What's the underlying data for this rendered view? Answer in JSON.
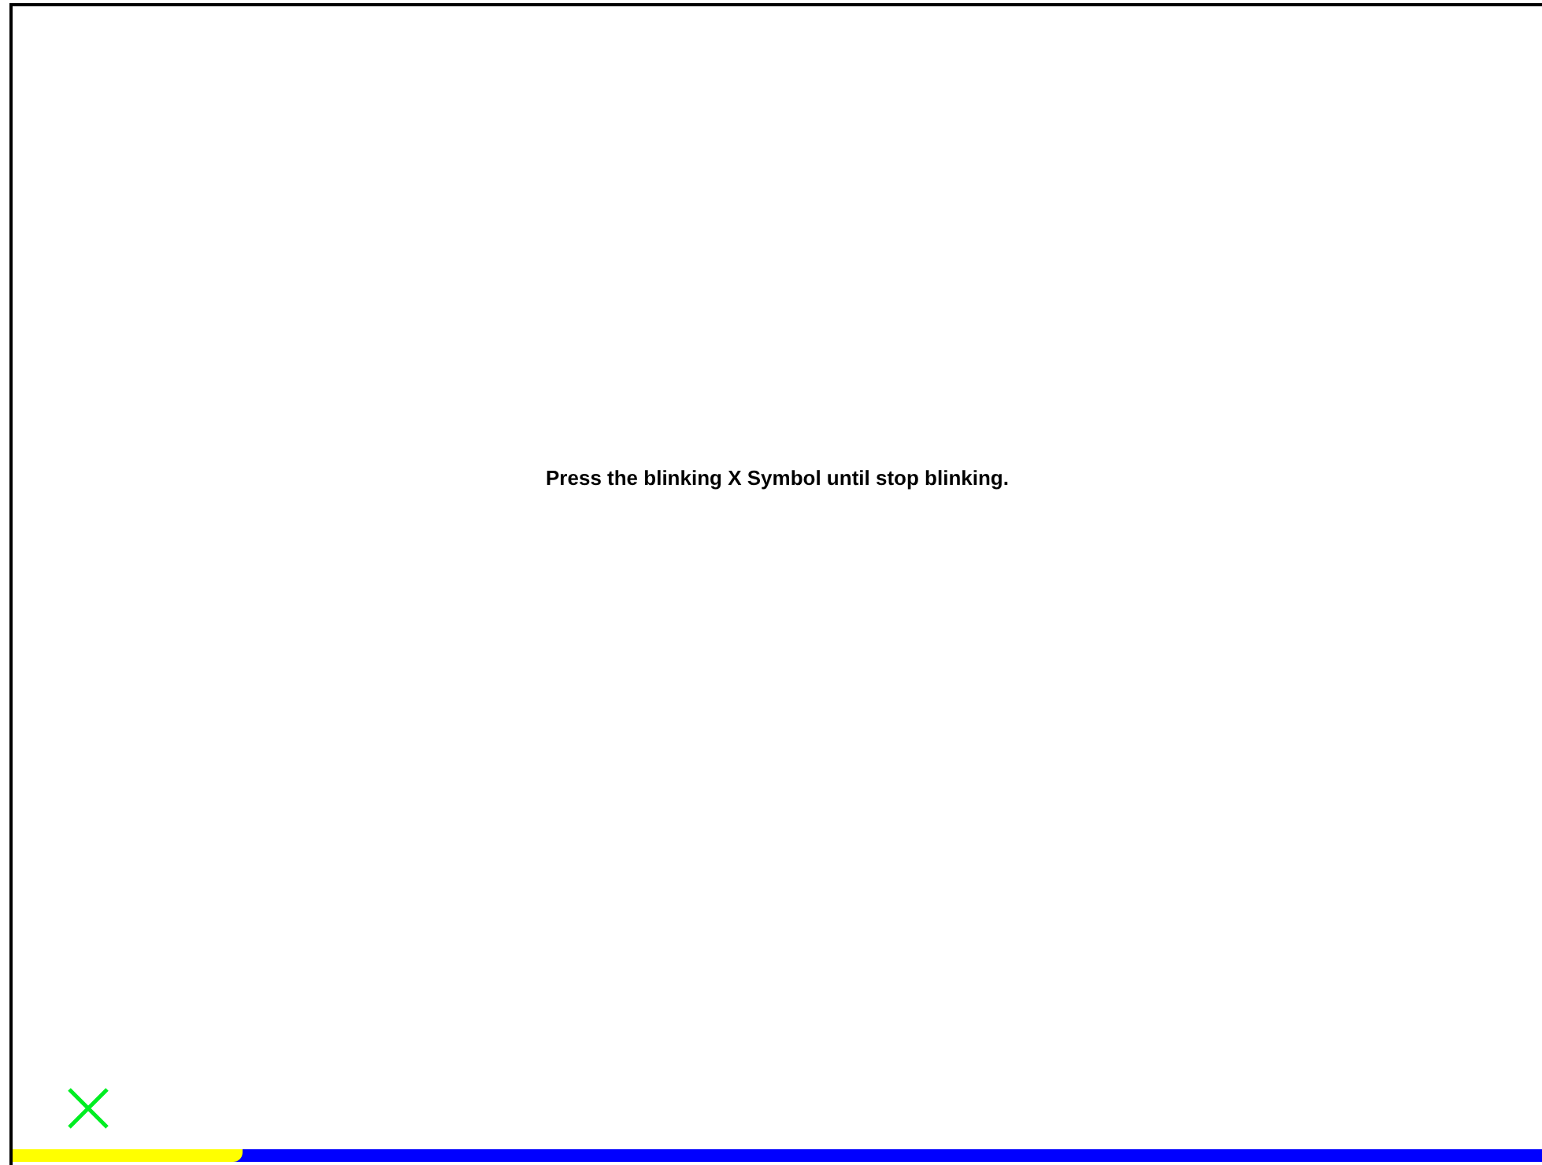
{
  "instruction": "Press the blinking X Symbol until stop blinking.",
  "progress": {
    "level": 0.15
  }
}
